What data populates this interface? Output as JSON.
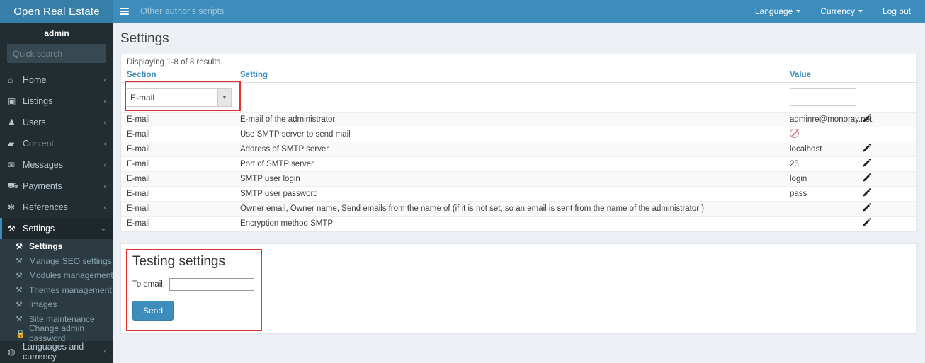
{
  "header": {
    "logo": "Open Real Estate",
    "menu_toggle_icon": "hamburger-icon",
    "breadcrumb": "Other author's scripts",
    "right_links": [
      {
        "label": "Language",
        "caret": true
      },
      {
        "label": "Currency",
        "caret": true
      },
      {
        "label": "Log out",
        "caret": false
      }
    ]
  },
  "sidebar": {
    "user": "admin",
    "search": {
      "placeholder": "Quick search",
      "value": "",
      "icon": "search-icon"
    },
    "items": [
      {
        "label": "Home",
        "icon": "home-icon",
        "glyph": "⌂",
        "arrow": "‹",
        "active": false
      },
      {
        "label": "Listings",
        "icon": "grid-icon",
        "glyph": "▣",
        "arrow": "‹",
        "active": false
      },
      {
        "label": "Users",
        "icon": "user-icon",
        "glyph": "♟",
        "arrow": "‹",
        "active": false
      },
      {
        "label": "Content",
        "icon": "folder-icon",
        "glyph": "▰",
        "arrow": "‹",
        "active": false
      },
      {
        "label": "Messages",
        "icon": "envelope-icon",
        "glyph": "✉",
        "arrow": "‹",
        "active": false
      },
      {
        "label": "Payments",
        "icon": "cart-icon",
        "glyph": "⛟",
        "arrow": "‹",
        "active": false
      },
      {
        "label": "References",
        "icon": "asterisk-icon",
        "glyph": "✻",
        "arrow": "‹",
        "active": false
      },
      {
        "label": "Settings",
        "icon": "wrench-icon",
        "glyph": "⚒",
        "arrow": "⌄",
        "active": true
      }
    ],
    "submenu": [
      {
        "label": "Settings",
        "icon": "wrench-icon",
        "glyph": "⚒",
        "current": true
      },
      {
        "label": "Manage SEO settings",
        "icon": "wrench-icon",
        "glyph": "⚒",
        "current": false
      },
      {
        "label": "Modules management",
        "icon": "wrench-icon",
        "glyph": "⚒",
        "current": false
      },
      {
        "label": "Themes management",
        "icon": "wrench-icon",
        "glyph": "⚒",
        "current": false
      },
      {
        "label": "Images",
        "icon": "wrench-icon",
        "glyph": "⚒",
        "current": false
      },
      {
        "label": "Site maintenance",
        "icon": "wrench-icon",
        "glyph": "⚒",
        "current": false
      },
      {
        "label": "Change admin password",
        "icon": "lock-icon",
        "glyph": "ὑ2",
        "current": false
      }
    ],
    "bottom_item": {
      "label": "Languages and currency",
      "icon": "globe-icon",
      "glyph": "◍",
      "arrow": "‹"
    }
  },
  "page": {
    "title": "Settings",
    "summary": "Displaying 1-8 of 8 results."
  },
  "table": {
    "columns": [
      "Section",
      "Setting",
      "Value",
      ""
    ],
    "filters": {
      "section_selected": "E-mail",
      "section_options": [
        "E-mail"
      ],
      "value_text": "",
      "dropdown_icon": "chevron-down-icon"
    },
    "rows": [
      {
        "section": "E-mail",
        "setting": "E-mail of the administrator",
        "value": "adminre@monoray.net",
        "value_type": "text",
        "edit_icon": "pencil-icon"
      },
      {
        "section": "E-mail",
        "setting": "Use SMTP server to send mail",
        "value": "",
        "value_type": "ban",
        "edit_icon": ""
      },
      {
        "section": "E-mail",
        "setting": "Address of SMTP server",
        "value": "localhost",
        "value_type": "text",
        "edit_icon": "pencil-icon"
      },
      {
        "section": "E-mail",
        "setting": "Port of SMTP server",
        "value": "25",
        "value_type": "text",
        "edit_icon": "pencil-icon"
      },
      {
        "section": "E-mail",
        "setting": "SMTP user login",
        "value": "login",
        "value_type": "text",
        "edit_icon": "pencil-icon"
      },
      {
        "section": "E-mail",
        "setting": "SMTP user password",
        "value": "pass",
        "value_type": "text",
        "edit_icon": "pencil-icon"
      },
      {
        "section": "E-mail",
        "setting": "Owner email, Owner name, Send emails from the name of (if it is not set, so an email is sent from the name of the administrator )",
        "value": "",
        "value_type": "text",
        "edit_icon": "pencil-icon"
      },
      {
        "section": "E-mail",
        "setting": "Encryption method SMTP",
        "value": "",
        "value_type": "text",
        "edit_icon": "pencil-icon"
      }
    ]
  },
  "testing": {
    "title": "Testing settings",
    "to_email_label": "To email:",
    "to_email_value": "",
    "send_label": "Send"
  },
  "colors": {
    "brand_blue": "#3c8dbc",
    "brand_blue_dark": "#367fa9",
    "sidebar_dark": "#222d32",
    "submenu_dark": "#2c3b41",
    "content_bg": "#ecf0f5",
    "annotation_red": "#e03030",
    "ban_red": "#c9818f"
  },
  "annotations": [
    {
      "name": "section-filter-highlight"
    },
    {
      "name": "testing-settings-highlight"
    }
  ]
}
